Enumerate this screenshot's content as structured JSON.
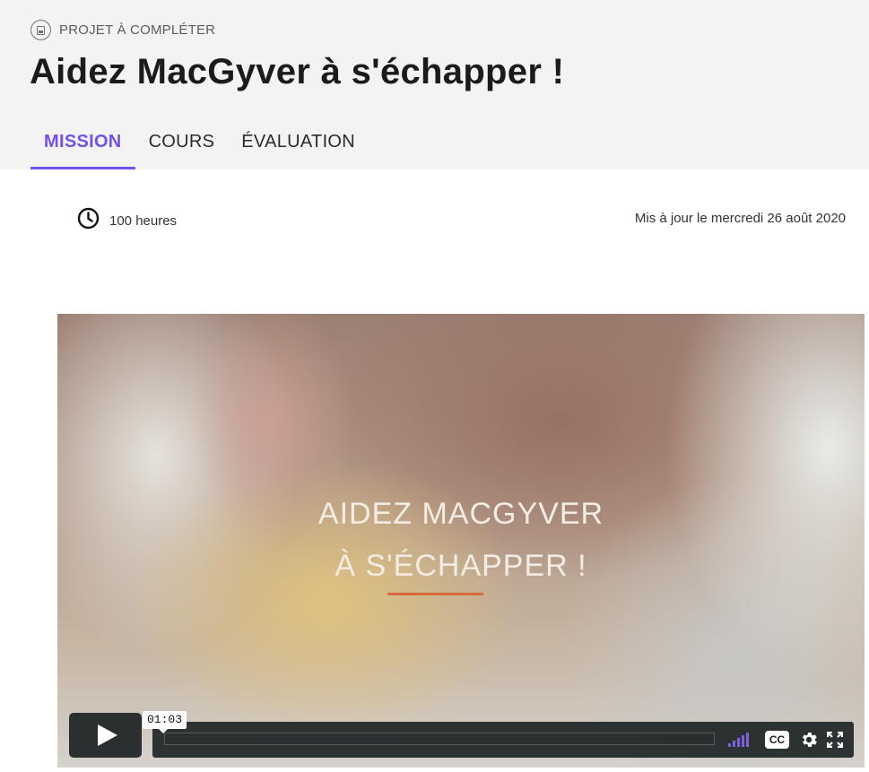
{
  "header": {
    "kind_label": "PROJET À COMPLÉTER",
    "kind_icon": "project-icon",
    "title": "Aidez MacGyver à s'échapper !"
  },
  "tabs": [
    {
      "label": "MISSION",
      "active": true
    },
    {
      "label": "COURS",
      "active": false
    },
    {
      "label": "ÉVALUATION",
      "active": false
    }
  ],
  "meta": {
    "duration_icon": "clock-icon",
    "duration": "100 heures",
    "updated": "Mis à jour le mercredi 26 août 2020"
  },
  "video": {
    "overlay_line1": "AIDEZ MACGYVER",
    "overlay_line2": "À S'ÉCHAPPER !",
    "time_tooltip": "01:03",
    "cc_label": "CC",
    "volume_level": 1.0
  },
  "colors": {
    "accent": "#7451eb",
    "header_bg": "#f3f3f3",
    "underline": "#d66a3a"
  }
}
